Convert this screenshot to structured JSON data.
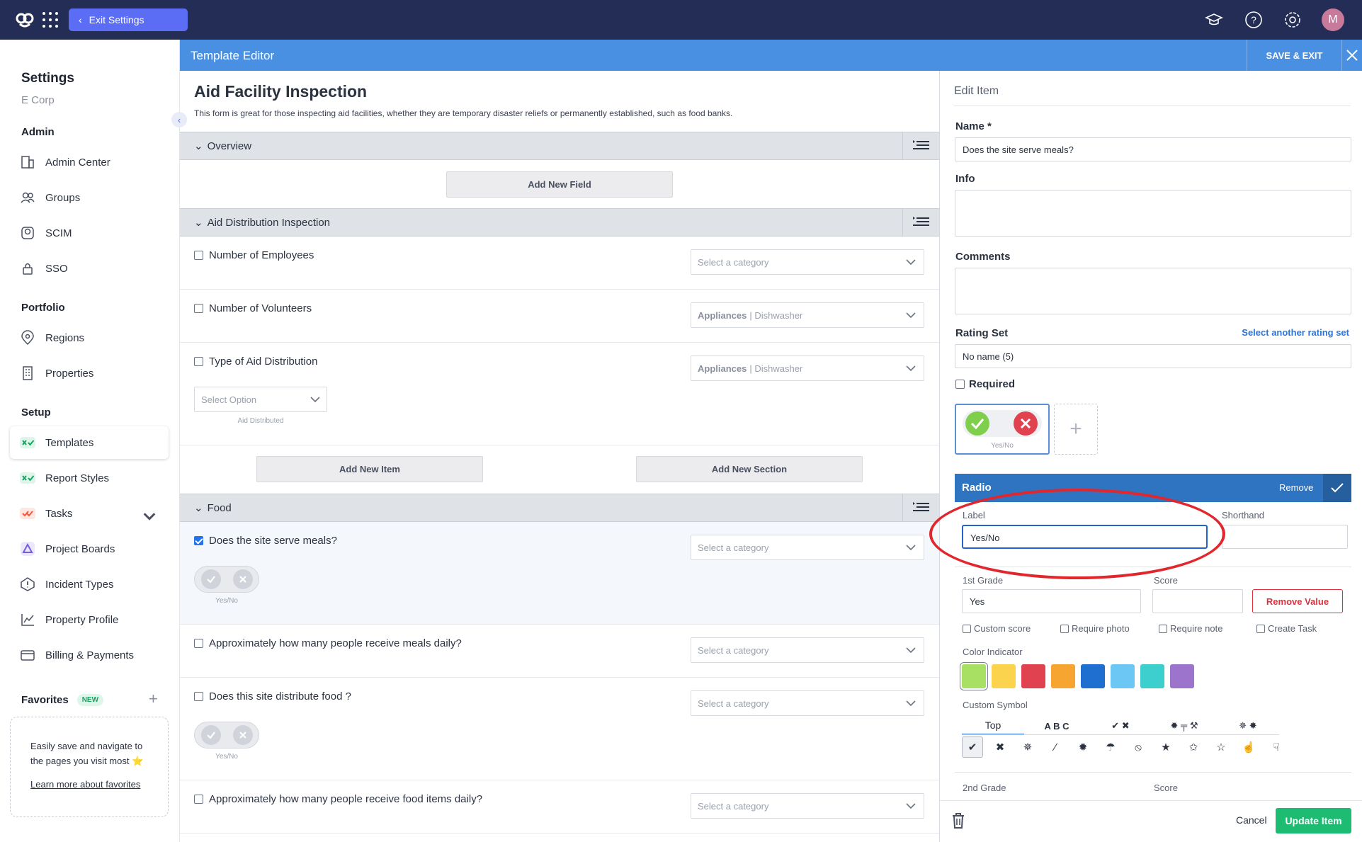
{
  "topbar": {
    "exit_label": "Exit Settings",
    "avatar_initial": "M",
    "icons": [
      "logo-icon",
      "apps-grid-icon",
      "graduation-cap-icon",
      "help-icon",
      "gear-icon"
    ]
  },
  "sidebar": {
    "title": "Settings",
    "org": "E Corp",
    "admin_heading": "Admin",
    "admin_items": [
      "Admin Center",
      "Groups",
      "SCIM",
      "SSO"
    ],
    "portfolio_heading": "Portfolio",
    "portfolio_items": [
      "Regions",
      "Properties"
    ],
    "setup_heading": "Setup",
    "setup_items": [
      "Templates",
      "Report Styles",
      "Tasks",
      "Project Boards",
      "Incident Types",
      "Property Profile",
      "Billing & Payments"
    ],
    "active_item": "Templates",
    "favorites": {
      "heading": "Favorites",
      "badge": "NEW",
      "text": "Easily save and navigate to the pages you visit most ⭐",
      "link": "Learn more about favorites"
    }
  },
  "editor": {
    "title": "Template Editor",
    "save_exit": "SAVE & EXIT"
  },
  "form": {
    "title": "Aid Facility Inspection",
    "description": "This form is great for those inspecting aid facilities, whether they are temporary disaster reliefs or permanently established, such as food banks.",
    "sections": [
      {
        "name": "Overview",
        "add_field": "Add New Field"
      },
      {
        "name": "Aid Distribution Inspection"
      },
      {
        "name": "Food"
      }
    ],
    "aid_items": [
      {
        "label": "Number of Employees",
        "category": "Select a category"
      },
      {
        "label": "Number of Volunteers",
        "category_bold": "Appliances",
        "category_rest": "| Dishwasher"
      },
      {
        "label": "Type of Aid Distribution",
        "category_bold": "Appliances",
        "category_rest": "| Dishwasher",
        "option_placeholder": "Select Option",
        "option_caption": "Aid Distributed"
      }
    ],
    "add_item": "Add New Item",
    "add_section": "Add New Section",
    "food_items": [
      {
        "label": "Does the site serve meals?",
        "category": "Select a category",
        "checked": true,
        "rating_caption": "Yes/No"
      },
      {
        "label": "Approximately how many people receive meals daily?",
        "category": "Select a category",
        "checked": false
      },
      {
        "label": "Does this site distribute food ?",
        "category": "Select a category",
        "checked": false,
        "rating_caption": "Yes/No"
      },
      {
        "label": "Approximately how many people receive food items daily?",
        "category": "Select a category",
        "checked": false
      }
    ]
  },
  "edit_item": {
    "title": "Edit Item",
    "name_label": "Name *",
    "name_value": "Does the site serve meals?",
    "info_label": "Info",
    "comments_label": "Comments",
    "rating_set_label": "Rating Set",
    "rating_set_link": "Select another rating set",
    "rating_set_value": "No name (5)",
    "required_label": "Required",
    "rating_card_caption": "Yes/No",
    "radio": {
      "title": "Radio",
      "remove": "Remove",
      "label_label": "Label",
      "label_value": "Yes/No",
      "shorthand_label": "Shorthand",
      "shorthand_value": ""
    },
    "grade1": {
      "label": "1st Grade",
      "value": "Yes",
      "score_label": "Score",
      "score_value": "",
      "remove_value": "Remove Value",
      "options": [
        "Custom score",
        "Require photo",
        "Require note",
        "Create Task"
      ]
    },
    "color_indicator_label": "Color Indicator",
    "colors": [
      "#a8e063",
      "#fcd34d",
      "#e0434f",
      "#f6a531",
      "#1e6fcf",
      "#6cc7f4",
      "#3dcfce",
      "#9d74cc"
    ],
    "selected_color": "#a8e063",
    "custom_symbol_label": "Custom Symbol",
    "symbol_tabs": [
      "Top",
      "A B C",
      "✔ ✖",
      "✹ ╤ ⚒",
      "✵ ✸"
    ],
    "symbols": [
      "✔",
      "✖",
      "✵",
      "∕",
      "✹",
      "☂",
      "⦸",
      "★",
      "✩",
      "☆",
      "☝",
      "☟"
    ],
    "grade2": {
      "label": "2nd Grade",
      "score_label": "Score"
    },
    "cancel": "Cancel",
    "update": "Update Item"
  }
}
